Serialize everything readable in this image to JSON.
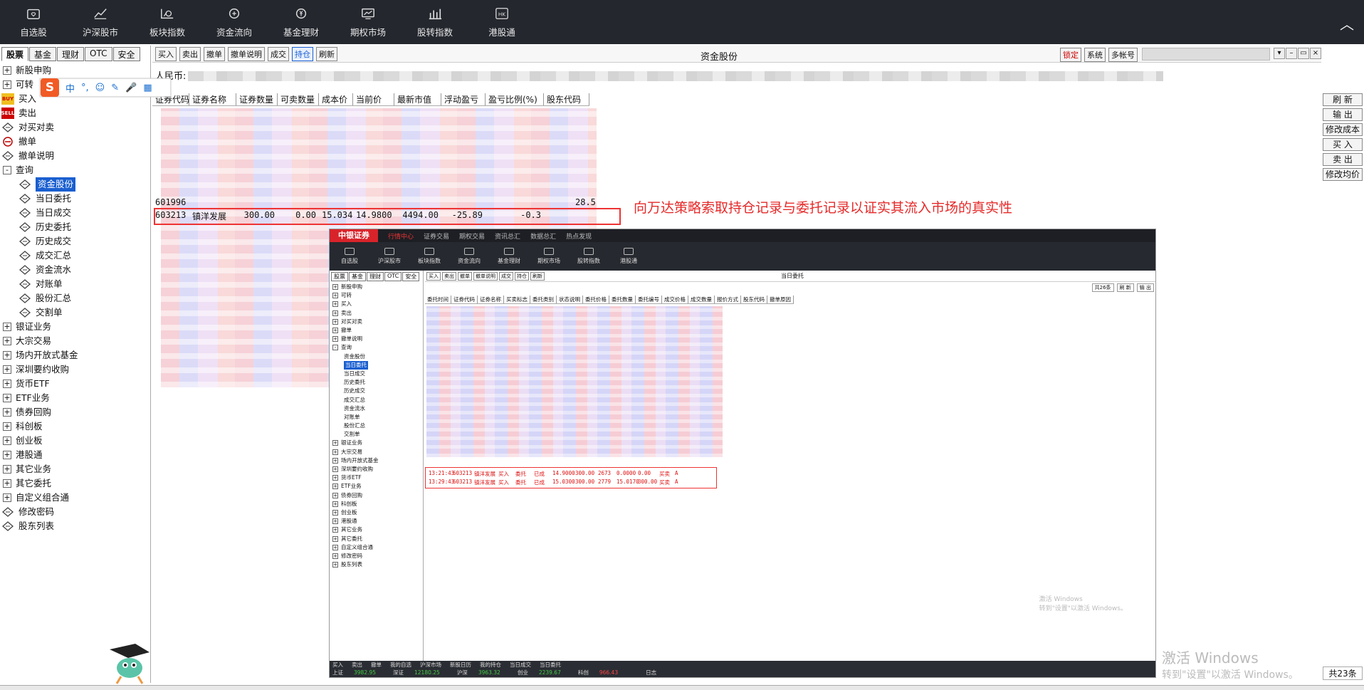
{
  "topnav": {
    "items": [
      {
        "label": "自选股",
        "icon": "heart-folder-icon"
      },
      {
        "label": "沪深股市",
        "icon": "line-chart-icon"
      },
      {
        "label": "板块指数",
        "icon": "sector-chart-icon"
      },
      {
        "label": "资金流向",
        "icon": "money-flow-icon"
      },
      {
        "label": "基金理财",
        "icon": "fund-icon"
      },
      {
        "label": "期权市场",
        "icon": "options-icon"
      },
      {
        "label": "股转指数",
        "icon": "bar-chart-icon"
      },
      {
        "label": "港股通",
        "icon": "hk-icon"
      }
    ],
    "hk_text": "HK",
    "collapse": "︿"
  },
  "left": {
    "tabs": [
      "股票",
      "基金",
      "理财",
      "OTC",
      "安全"
    ],
    "tree": [
      {
        "label": "新股申购",
        "type": "plus"
      },
      {
        "label": "可转",
        "type": "plus"
      },
      {
        "label": "买入",
        "type": "buy"
      },
      {
        "label": "卖出",
        "type": "sell"
      },
      {
        "label": "对买对卖",
        "type": "icon"
      },
      {
        "label": "撤单",
        "type": "cancel"
      },
      {
        "label": "撤单说明",
        "type": "icon"
      },
      {
        "label": "查询",
        "type": "minus"
      }
    ],
    "query_children": [
      "资金股份",
      "当日委托",
      "当日成交",
      "历史委托",
      "历史成交",
      "成交汇总",
      "资金流水",
      "对账单",
      "股份汇总",
      "交割单"
    ],
    "tree_after": [
      "银证业务",
      "大宗交易",
      "场内开放式基金",
      "深圳要约收购",
      "货币ETF",
      "ETF业务",
      "债券回购",
      "科创板",
      "创业板",
      "港股通",
      "其它业务",
      "其它委托",
      "自定义组合通"
    ],
    "tree_tail": [
      "修改密码",
      "股东列表"
    ]
  },
  "toolbar": {
    "buttons": [
      "买入",
      "卖出",
      "撤单",
      "撤单说明",
      "成交",
      "持仓",
      "刷新"
    ],
    "active": "持仓",
    "title": "资金股份",
    "right_buttons": [
      "锁定",
      "系统",
      "多帐号"
    ]
  },
  "main": {
    "currency_label": "人民币:",
    "headers": [
      "证券代码",
      "证券名称",
      "证券数量",
      "可卖数量",
      "成本价",
      "当前价",
      "最新市值",
      "浮动盈亏",
      "盈亏比例(%)",
      "股东代码"
    ],
    "highlight_row": [
      "603213",
      "镇洋发展",
      "300.00",
      "0.00",
      "15.034",
      "14.9800",
      "4494.00",
      "-25.89",
      "-0.3"
    ],
    "row_above": {
      "code": "601996",
      "ratio": "28.5"
    },
    "annotation": "向万达策略索取持仓记录与委托记录以证实其流入市场的真实性",
    "right_buttons": [
      "刷 新",
      "输 出",
      "修改成本",
      "买 入",
      "卖 出",
      "修改均价"
    ],
    "count": "共23条"
  },
  "embed": {
    "brand": "中银证券",
    "menu": [
      "行情中心",
      "证券交易",
      "期权交易",
      "资讯总汇",
      "数据总汇",
      "热点发现"
    ],
    "nav": [
      "自选股",
      "沪深股市",
      "板块指数",
      "资金流向",
      "基金理财",
      "期权市场",
      "股转指数",
      "港股通"
    ],
    "tabs": [
      "股票",
      "基金",
      "理财",
      "OTC",
      "安全"
    ],
    "tree": [
      "新股申购",
      "可转",
      "买入",
      "卖出",
      "对买对卖",
      "撤单",
      "撤单说明",
      "查询"
    ],
    "query_children": [
      "资金股份",
      "当日委托",
      "当日成交",
      "历史委托",
      "历史成交",
      "成交汇总",
      "资金流水",
      "对账单",
      "股份汇总",
      "交割单"
    ],
    "tree_after": [
      "银证业务",
      "大宗交易",
      "场内开放式基金",
      "深圳要约收购",
      "货币ETF",
      "ETF业务",
      "债券回购",
      "科创板",
      "创业板",
      "港股通",
      "其它业务",
      "其它委托",
      "自定义组合通",
      "修改密码",
      "股东列表"
    ],
    "toolbar": [
      "买入",
      "卖出",
      "撤单",
      "撤单说明",
      "成交",
      "持仓",
      "刷新"
    ],
    "title": "当日委托",
    "right_controls": [
      "共26条",
      "刷 新",
      "输 出"
    ],
    "headers": [
      "委托时间",
      "证券代码",
      "证券名称",
      "买卖标志",
      "委托类别",
      "状态说明",
      "委托价格",
      "委托数量",
      "委托编号",
      "成交价格",
      "成交数量",
      "报价方式",
      "股东代码",
      "撤单原因"
    ],
    "rows": [
      [
        "13:21:43",
        "603213",
        "镇洋发展",
        "买入",
        "委托",
        "已成",
        "14.9000",
        "300.00",
        "2673",
        "0.0000",
        "0.00",
        "买卖",
        "A"
      ],
      [
        "13:29:43",
        "603213",
        "镇洋发展",
        "买入",
        "委托",
        "已成",
        "15.0300",
        "300.00",
        "2779",
        "15.0170",
        "300.00",
        "买卖",
        "A"
      ]
    ],
    "watermark_title": "激活 Windows",
    "watermark_sub": "转到\"设置\"以激活 Windows。",
    "bottom_r1": [
      "买入",
      "卖出",
      "撤单",
      "我的自选",
      "沪深市场",
      "新股日历",
      "我的持仓",
      "当日成交",
      "当日委托"
    ],
    "bottom_r2": [
      {
        "label": "上证",
        "value": "3982.95",
        "dir": "down"
      },
      {
        "label": "深证",
        "value": "12180.25",
        "dir": "down"
      },
      {
        "label": "沪深",
        "value": "3963.32",
        "dir": "down"
      },
      {
        "label": "创业",
        "value": "2239.67",
        "dir": "down"
      },
      {
        "label": "科创",
        "value": "966.43",
        "dir": "up"
      },
      {
        "label": "",
        "value": "日志",
        "dir": "none"
      }
    ]
  },
  "watermark": {
    "title": "激活 Windows",
    "subtitle": "转到\"设置\"以激活 Windows。"
  },
  "ime": {
    "logo": "S",
    "items": [
      "中",
      "°,",
      "☺",
      "✎",
      "🎤",
      "▦"
    ]
  }
}
